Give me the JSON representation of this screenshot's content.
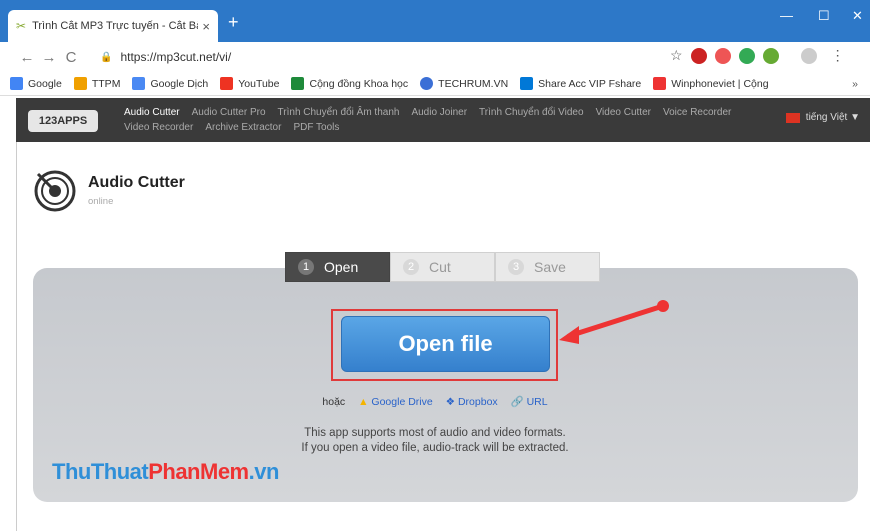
{
  "browser": {
    "tab_title": "Trình Cắt MP3 Trực tuyến - Cắt Bài",
    "tab_close": "×",
    "new_tab": "+",
    "window_controls": [
      "—",
      "☐",
      "✕"
    ],
    "url": "https://mp3cut.net/vi/",
    "bookmarks": [
      {
        "label": "Google",
        "color": "#4285f4"
      },
      {
        "label": "TTPM",
        "color": "#f0a000"
      },
      {
        "label": "Google Dịch",
        "color": "#4a89f3"
      },
      {
        "label": "YouTube",
        "color": "#e32"
      },
      {
        "label": "Cộng đồng Khoa học",
        "color": "#1e8a3a"
      },
      {
        "label": "TECHRUM.VN",
        "color": "#3b6fd6"
      },
      {
        "label": "Share Acc VIP Fshare",
        "color": "#0078d7"
      },
      {
        "label": "Winphoneviet | Cộng",
        "color": "#e33"
      }
    ],
    "bookmarks_more": "»"
  },
  "apps_bar": {
    "logo": "123APPS",
    "menu": [
      "Audio Cutter",
      "Audio Cutter Pro",
      "Trình Chuyển đổi Âm thanh",
      "Audio Joiner",
      "Trình Chuyển đổi Video",
      "Video Cutter",
      "Voice Recorder",
      "Video Recorder",
      "Archive Extractor",
      "PDF Tools"
    ],
    "language": "tiếng Việt ▼"
  },
  "app": {
    "title": "Audio Cutter",
    "subtitle": "online"
  },
  "steps": [
    {
      "num": "1",
      "label": "Open"
    },
    {
      "num": "2",
      "label": "Cut"
    },
    {
      "num": "3",
      "label": "Save"
    }
  ],
  "main": {
    "open_button": "Open file",
    "or_text": "hoặc",
    "google_drive": "Google Drive",
    "dropbox": "Dropbox",
    "url": "URL",
    "info_line1": "This app supports most of audio and video formats.",
    "info_line2": "If you open a video file, audio-track will be extracted."
  },
  "watermark": {
    "part1": "ThuThuat",
    "part2": "PhanMem",
    "part3": ".vn"
  }
}
